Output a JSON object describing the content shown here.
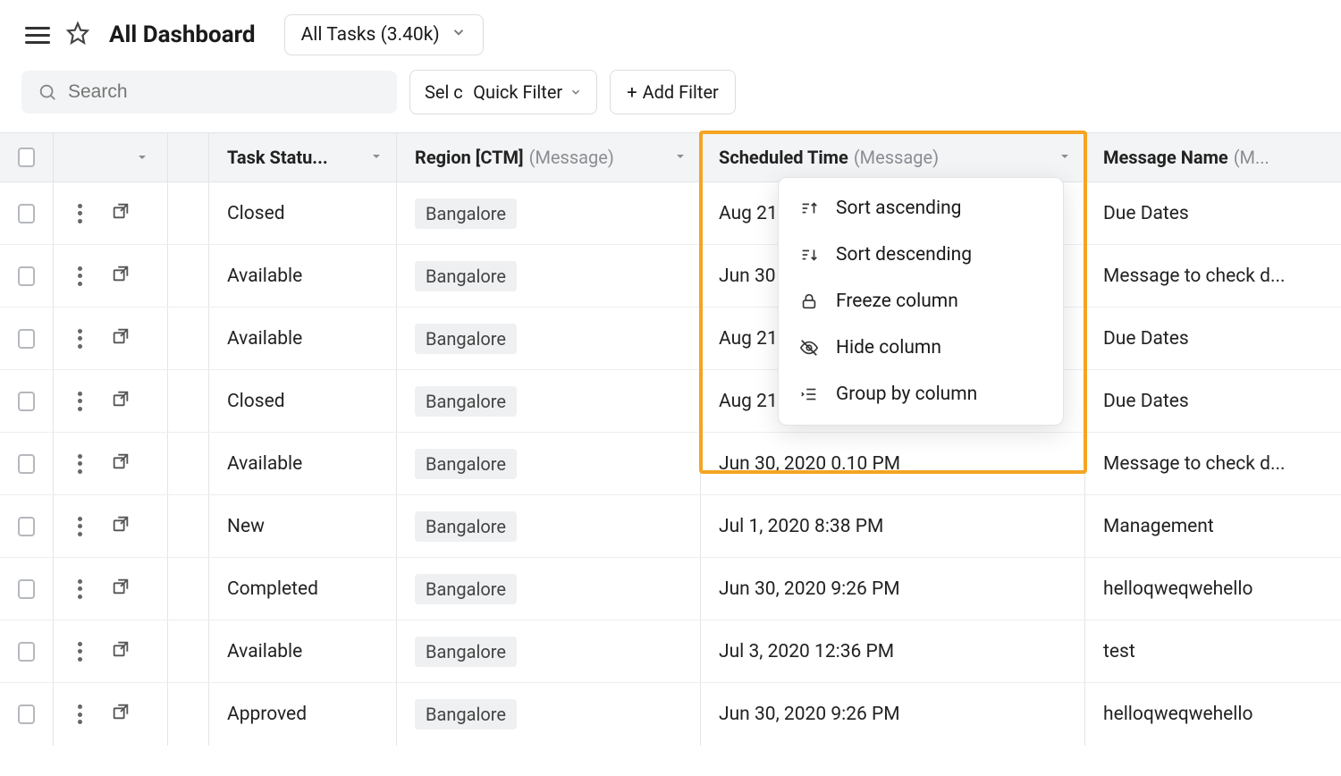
{
  "header": {
    "title": "All Dashboard",
    "task_filter_label": "All Tasks  (3.40k)"
  },
  "filters": {
    "search_placeholder": "Search",
    "quick_filter_label": "Sel  ct Quick Filter",
    "add_filter_label": "Add Filter"
  },
  "columns": {
    "status": {
      "label": "Task Statu...",
      "secondary": ""
    },
    "region": {
      "label": "Region [CTM]",
      "secondary": "(Message)"
    },
    "scheduled": {
      "label": "Scheduled Time",
      "secondary": "(Message)"
    },
    "message": {
      "label": "Message Name",
      "secondary": "(M..."
    }
  },
  "column_menu": {
    "sort_asc": "Sort ascending",
    "sort_desc": "Sort descending",
    "freeze": "Freeze column",
    "hide": "Hide column",
    "group": "Group by column"
  },
  "rows": [
    {
      "status": "Closed",
      "region": "Bangalore",
      "scheduled": "Aug 21",
      "message": "Due Dates"
    },
    {
      "status": "Available",
      "region": "Bangalore",
      "scheduled": "Jun 30",
      "message": "Message to check d..."
    },
    {
      "status": "Available",
      "region": "Bangalore",
      "scheduled": "Aug 21",
      "message": "Due Dates"
    },
    {
      "status": "Closed",
      "region": "Bangalore",
      "scheduled": "Aug 21",
      "message": "Due Dates"
    },
    {
      "status": "Available",
      "region": "Bangalore",
      "scheduled": "Jun 30, 2020 0.10 PM",
      "message": "Message to check d..."
    },
    {
      "status": "New",
      "region": "Bangalore",
      "scheduled": "Jul 1, 2020 8:38 PM",
      "message": "Management"
    },
    {
      "status": "Completed",
      "region": "Bangalore",
      "scheduled": "Jun 30, 2020 9:26 PM",
      "message": "helloqweqwehello"
    },
    {
      "status": "Available",
      "region": "Bangalore",
      "scheduled": "Jul 3, 2020 12:36 PM",
      "message": "test"
    },
    {
      "status": "Approved",
      "region": "Bangalore",
      "scheduled": "Jun 30, 2020 9:26 PM",
      "message": "helloqweqwehello"
    }
  ]
}
